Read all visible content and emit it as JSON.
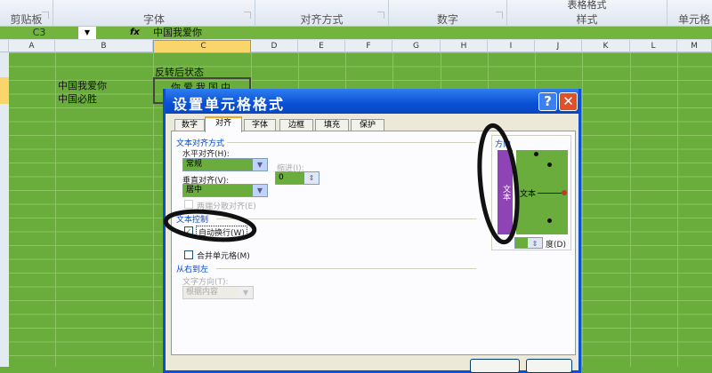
{
  "ribbon": {
    "groups": [
      "剪贴板",
      "字体",
      "对齐方式",
      "数字",
      "样式",
      "单元格"
    ],
    "partial_top": "表格格式"
  },
  "formula_bar": {
    "name_box": "C3",
    "fx": "fx",
    "value": "中国我爱你"
  },
  "columns": [
    "A",
    "B",
    "C",
    "D",
    "E",
    "F",
    "G",
    "H",
    "I",
    "J",
    "K",
    "L",
    "M"
  ],
  "cells": {
    "c2": "反转后状态",
    "c3": "你爱我国中",
    "b3": "中国我爱你",
    "b4": "中国必胜"
  },
  "dialog": {
    "title": "设置单元格格式",
    "help": "?",
    "close": "✕",
    "tabs": [
      "数字",
      "对齐",
      "字体",
      "边框",
      "填充",
      "保护"
    ],
    "active_tab": "对齐",
    "text_align_section": "文本对齐方式",
    "h_align_label": "水平对齐(H):",
    "h_align_value": "常规",
    "indent_label": "缩进(I):",
    "indent_value": "0",
    "v_align_label": "垂直对齐(V):",
    "v_align_value": "居中",
    "distributed_label": "两端分散对齐(E)",
    "text_control_section": "文本控制",
    "wrap_label": "自动换行(W)",
    "wrap_checked": true,
    "merge_label": "合并单元格(M)",
    "rtl_section": "从右到左",
    "direction_label": "文字方向(T):",
    "direction_value": "根据内容",
    "orientation_section": "方向",
    "vertical_text": "文本",
    "angled_text": "文本",
    "degree_label": "度(D)"
  },
  "colors": {
    "grid": "#6aad3c",
    "title_bar": "#0a4fd4",
    "vertical_box": "#8e44b5"
  }
}
